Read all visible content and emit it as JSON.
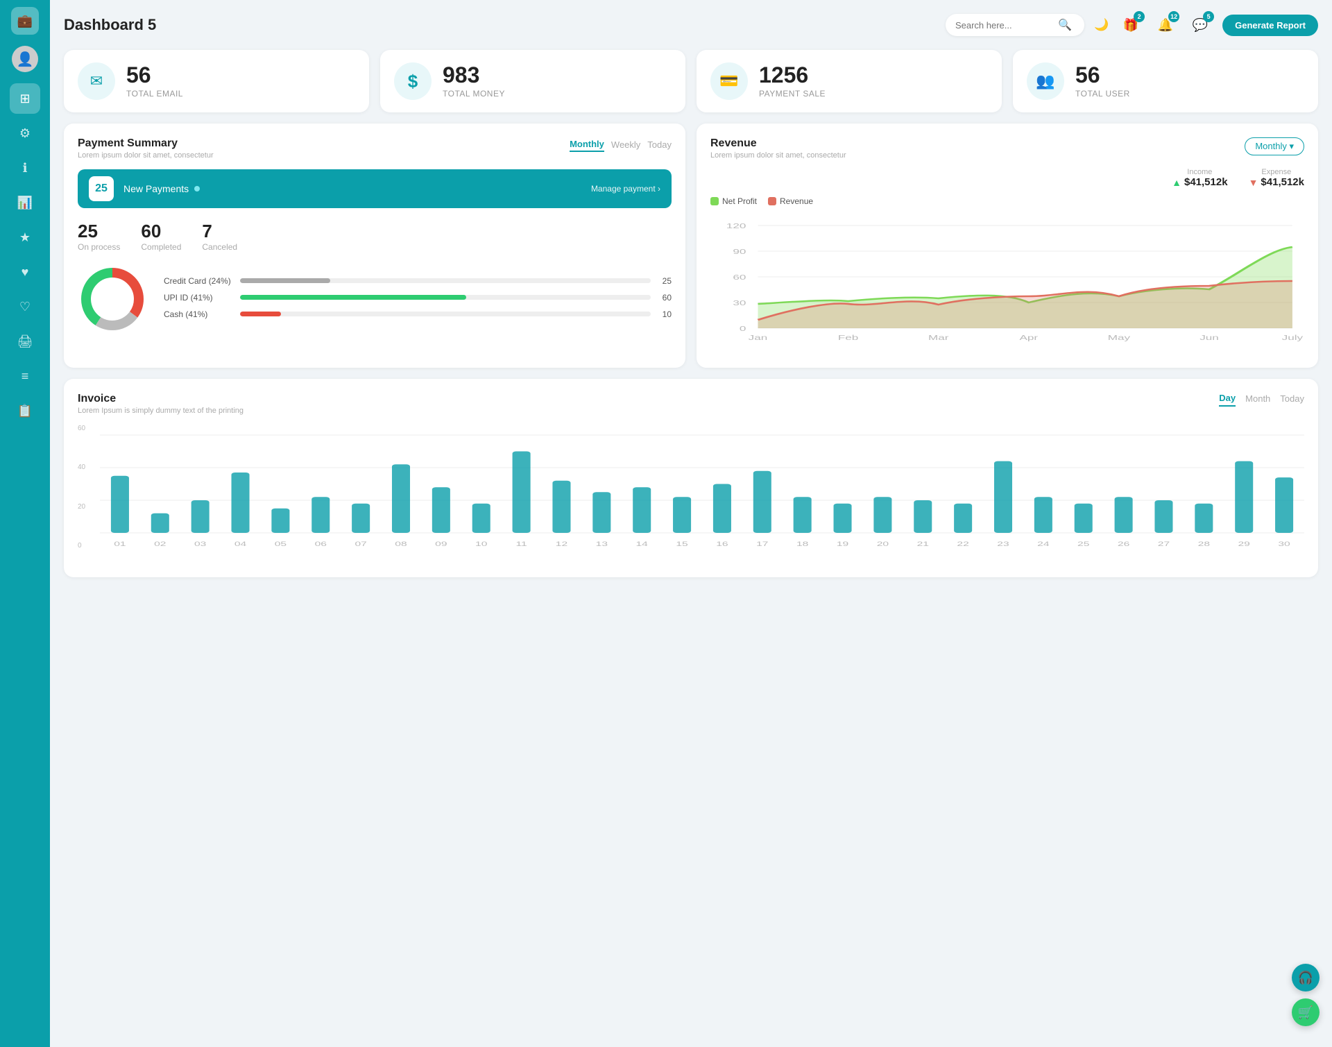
{
  "app": {
    "title": "Dashboard 5"
  },
  "topbar": {
    "search_placeholder": "Search here...",
    "generate_btn": "Generate Report",
    "badge_gift": "2",
    "badge_bell": "12",
    "badge_chat": "5"
  },
  "stat_cards": [
    {
      "id": "total-email",
      "number": "56",
      "label": "TOTAL EMAIL",
      "icon": "✉"
    },
    {
      "id": "total-money",
      "number": "983",
      "label": "TOTAL MONEY",
      "icon": "$"
    },
    {
      "id": "payment-sale",
      "number": "1256",
      "label": "PAYMENT SALE",
      "icon": "💳"
    },
    {
      "id": "total-user",
      "number": "56",
      "label": "TOTAL USER",
      "icon": "👥"
    }
  ],
  "payment_summary": {
    "title": "Payment Summary",
    "subtitle": "Lorem ipsum dolor sit amet, consectetur",
    "tabs": [
      "Monthly",
      "Weekly",
      "Today"
    ],
    "active_tab": "Monthly",
    "new_payments_count": "25",
    "new_payments_label": "New Payments",
    "manage_link": "Manage payment",
    "stats": [
      {
        "num": "25",
        "label": "On process"
      },
      {
        "num": "60",
        "label": "Completed"
      },
      {
        "num": "7",
        "label": "Canceled"
      }
    ],
    "progress_items": [
      {
        "label": "Credit Card (24%)",
        "pct": 22,
        "val": "25",
        "color": "#aaa"
      },
      {
        "label": "UPI ID (41%)",
        "pct": 55,
        "val": "60",
        "color": "#2ecc71"
      },
      {
        "label": "Cash (41%)",
        "pct": 10,
        "val": "10",
        "color": "#e74c3c"
      }
    ],
    "donut": {
      "segments": [
        {
          "label": "Credit Card",
          "pct": 24,
          "color": "#aaa"
        },
        {
          "label": "UPI ID",
          "pct": 41,
          "color": "#2ecc71"
        },
        {
          "label": "Cash",
          "pct": 35,
          "color": "#e74c3c"
        }
      ]
    }
  },
  "revenue": {
    "title": "Revenue",
    "subtitle": "Lorem ipsum dolor sit amet, consectetur",
    "active_tab": "Monthly",
    "income_label": "Income",
    "income_val": "$41,512k",
    "expense_label": "Expense",
    "expense_val": "$41,512k",
    "legend": [
      {
        "label": "Net Profit",
        "color": "#7ed957"
      },
      {
        "label": "Revenue",
        "color": "#e07060"
      }
    ],
    "x_labels": [
      "Jan",
      "Feb",
      "Mar",
      "Apr",
      "May",
      "Jun",
      "July"
    ],
    "y_labels": [
      "0",
      "30",
      "60",
      "90",
      "120"
    ],
    "net_profit_data": [
      28,
      32,
      35,
      30,
      38,
      45,
      95
    ],
    "revenue_data": [
      10,
      35,
      28,
      40,
      38,
      50,
      55
    ]
  },
  "invoice": {
    "title": "Invoice",
    "subtitle": "Lorem Ipsum is simply dummy text of the printing",
    "tabs": [
      "Day",
      "Month",
      "Today"
    ],
    "active_tab": "Day",
    "y_labels": [
      "0",
      "20",
      "40",
      "60"
    ],
    "x_labels": [
      "01",
      "02",
      "03",
      "04",
      "05",
      "06",
      "07",
      "08",
      "09",
      "10",
      "11",
      "12",
      "13",
      "14",
      "15",
      "16",
      "17",
      "18",
      "19",
      "20",
      "21",
      "22",
      "23",
      "24",
      "25",
      "26",
      "27",
      "28",
      "29",
      "30"
    ],
    "bar_data": [
      35,
      12,
      20,
      37,
      15,
      22,
      18,
      42,
      28,
      18,
      50,
      32,
      25,
      28,
      22,
      30,
      38,
      22,
      18,
      22,
      20,
      18,
      44,
      22,
      18,
      22,
      20,
      18,
      44,
      34
    ]
  },
  "sidebar": {
    "items": [
      {
        "id": "wallet",
        "icon": "💳",
        "active": true
      },
      {
        "id": "dashboard",
        "icon": "⊞",
        "active": true
      },
      {
        "id": "settings",
        "icon": "⚙",
        "active": false
      },
      {
        "id": "info",
        "icon": "ℹ",
        "active": false
      },
      {
        "id": "chart",
        "icon": "📊",
        "active": false
      },
      {
        "id": "star",
        "icon": "★",
        "active": false
      },
      {
        "id": "heart1",
        "icon": "♥",
        "active": false
      },
      {
        "id": "heart2",
        "icon": "♡",
        "active": false
      },
      {
        "id": "print",
        "icon": "🖨",
        "active": false
      },
      {
        "id": "menu",
        "icon": "≡",
        "active": false
      },
      {
        "id": "list",
        "icon": "📋",
        "active": false
      }
    ]
  },
  "float_btns": [
    {
      "id": "support",
      "icon": "🎧",
      "color": "#0b9faa"
    },
    {
      "id": "cart",
      "icon": "🛒",
      "color": "#2ecc71"
    }
  ]
}
